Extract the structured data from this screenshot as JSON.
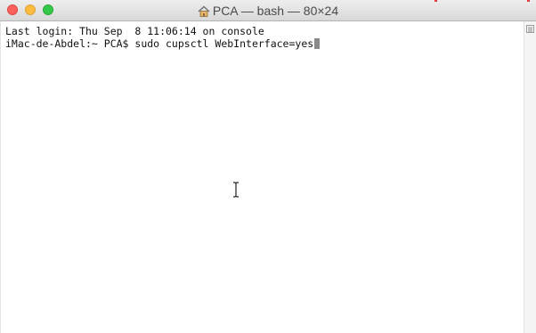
{
  "window": {
    "title": "PCA — bash — 80×24",
    "title_icon": "home-folder-icon"
  },
  "terminal": {
    "lines": [
      "Last login: Thu Sep  8 11:06:14 on console",
      "iMac-de-Abdel:~ PCA$ sudo cupsctl WebInterface=yes"
    ]
  },
  "colors": {
    "close": "#fc605b",
    "minimize": "#fdbc40",
    "maximize": "#34c84a",
    "cursor": "#8a8a8a",
    "text": "#111111"
  }
}
